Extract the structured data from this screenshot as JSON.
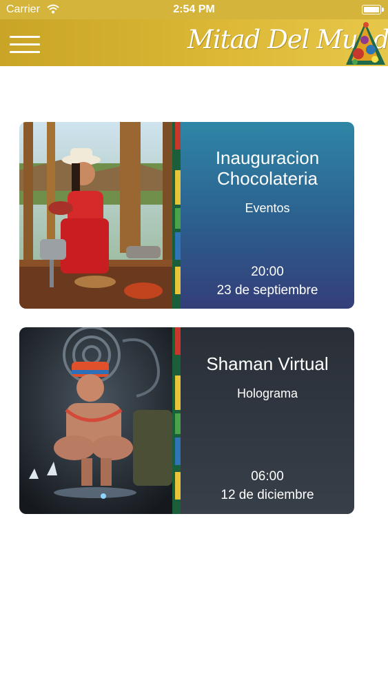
{
  "status_bar": {
    "carrier": "Carrier",
    "time": "2:54 PM"
  },
  "header": {
    "logo_text": "Mitad Del Mundo"
  },
  "events": [
    {
      "title": "Inauguracion Chocolateria",
      "category": "Eventos",
      "time": "20:00",
      "date": "23 de septiembre"
    },
    {
      "title": "Shaman Virtual",
      "category": "Holograma",
      "time": "06:00",
      "date": "12 de diciembre"
    }
  ],
  "colors": {
    "header": "#d4b43a",
    "card1_info": "#2c5e8d",
    "card2_info": "#313842"
  }
}
